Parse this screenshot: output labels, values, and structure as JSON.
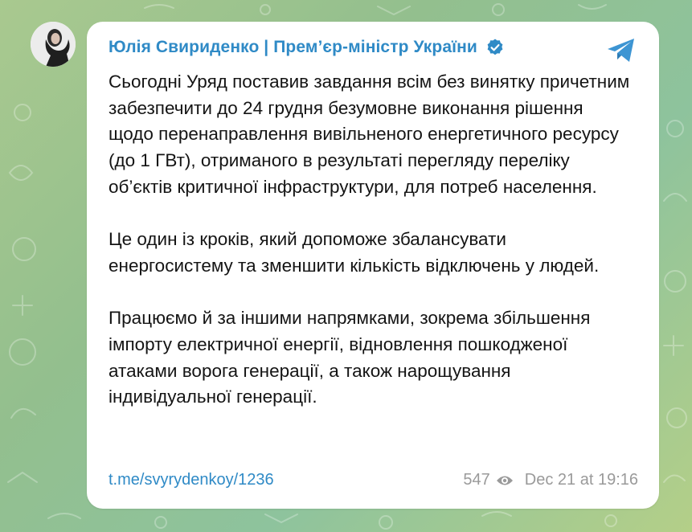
{
  "post": {
    "channel_name": "Юлія Свириденко | Прем’єр-міністр України",
    "paragraphs": [
      "Сьогодні Уряд поставив завдання всім без винятку причетним забезпечити до 24 грудня безумовне виконання рішення щодо перенаправлення вивільненого енергетичного ресурсу (до 1 ГВт), отриманого в результаті перегляду переліку об’єктів критичної інфраструктури, для потреб населення.",
      "Це один із кроків, який допоможе збалансувати енергосистему та зменшити кількість відключень у людей.",
      "Працюємо й за іншими напрямками, зокрема збільшення імпорту електричної енергії, відновлення пошкодженої атаками ворога генерації, а також нарощування індивідуальної генерації."
    ],
    "link": "t.me/svyrydenkoy/1236",
    "views": "547",
    "timestamp": "Dec 21 at 19:16"
  },
  "icons": {
    "verified": "verified-badge-icon",
    "share": "telegram-share-icon",
    "views": "eye-icon"
  },
  "colors": {
    "accent": "#2f8ac6",
    "text": "#141414",
    "meta": "#9a9a9a",
    "card": "#ffffff"
  }
}
